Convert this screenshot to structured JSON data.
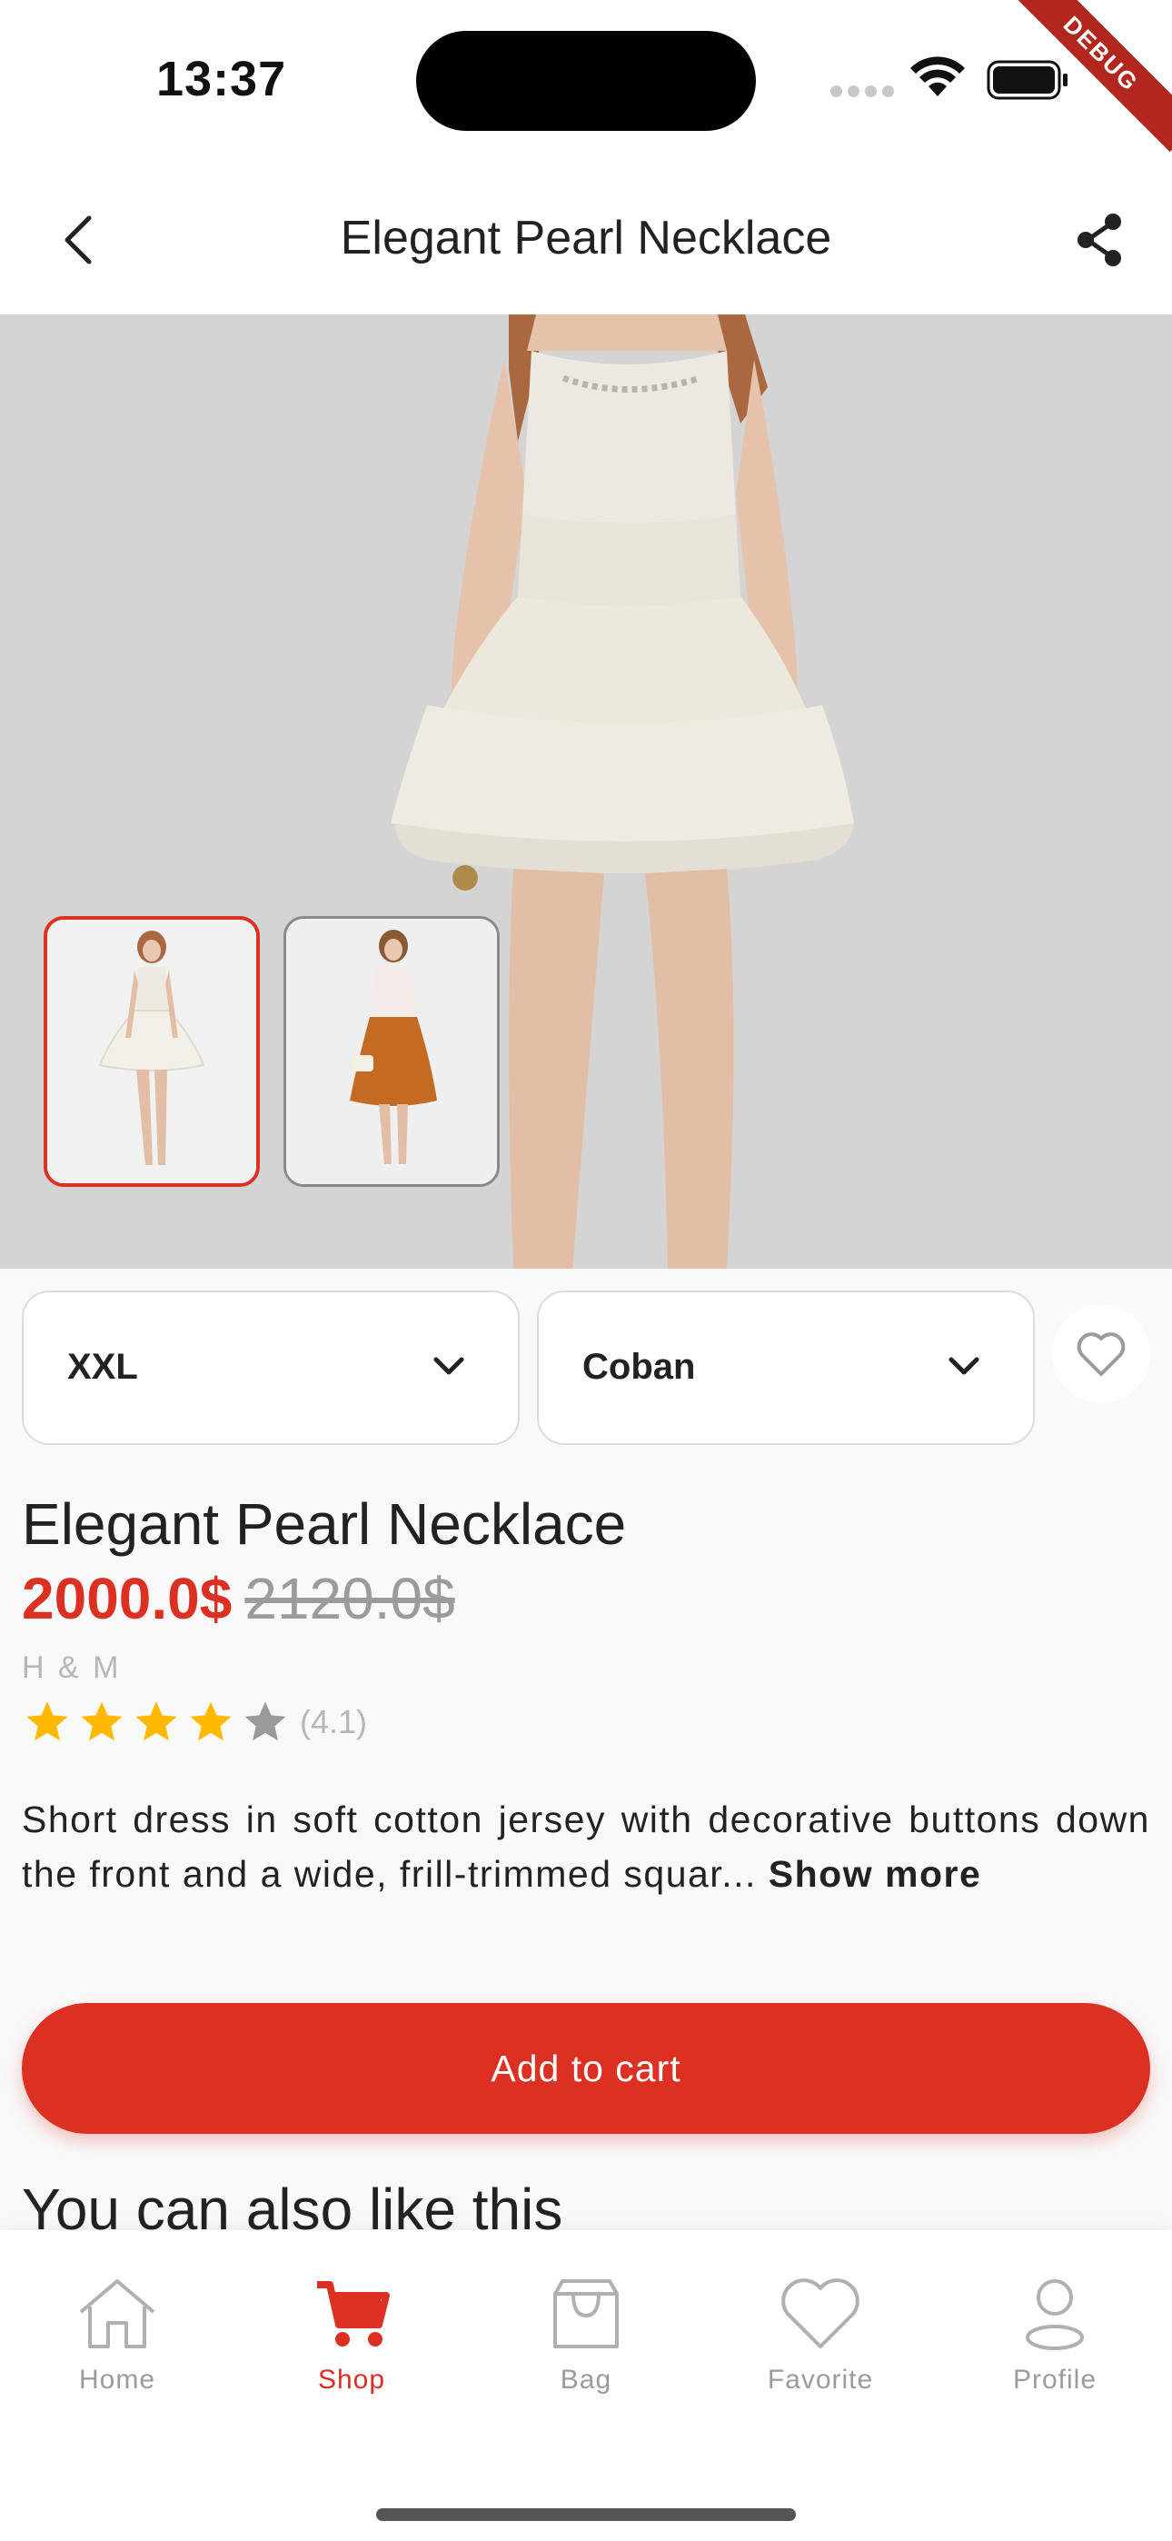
{
  "status_bar": {
    "time": "13:37",
    "debug_label": "DEBUG"
  },
  "header": {
    "title": "Elegant Pearl Necklace",
    "back_icon": "chevron-left-icon",
    "share_icon": "share-icon"
  },
  "gallery": {
    "selected_index": 0,
    "thumbnails": [
      {
        "name": "white-dress-thumbnail"
      },
      {
        "name": "rust-skirt-outfit-thumbnail"
      }
    ]
  },
  "selectors": {
    "size": {
      "value": "XXL"
    },
    "color": {
      "value": "Coban"
    },
    "favorite_icon": "heart-outline-icon"
  },
  "product": {
    "title": "Elegant Pearl Necklace",
    "price": "2000.0$",
    "old_price": "2120.0$",
    "brand": "H & M",
    "rating_value": 4.1,
    "rating_label": "(4.1)",
    "description": "Short dress in soft cotton jersey with decorative buttons down the front and a wide, frill-trimmed squar... ",
    "show_more": "Show more"
  },
  "actions": {
    "add_to_cart": "Add to cart"
  },
  "recommendations": {
    "title": "You can also like this"
  },
  "bottom_nav": {
    "active": "Shop",
    "items": [
      {
        "label": "Home",
        "icon": "home-icon"
      },
      {
        "label": "Shop",
        "icon": "cart-icon"
      },
      {
        "label": "Bag",
        "icon": "bag-icon"
      },
      {
        "label": "Favorite",
        "icon": "heart-icon"
      },
      {
        "label": "Profile",
        "icon": "profile-icon"
      }
    ]
  },
  "colors": {
    "accent": "#DB3022",
    "star": "#FFBA49",
    "muted": "#9B9B9B",
    "background": "#F9F9F9"
  }
}
